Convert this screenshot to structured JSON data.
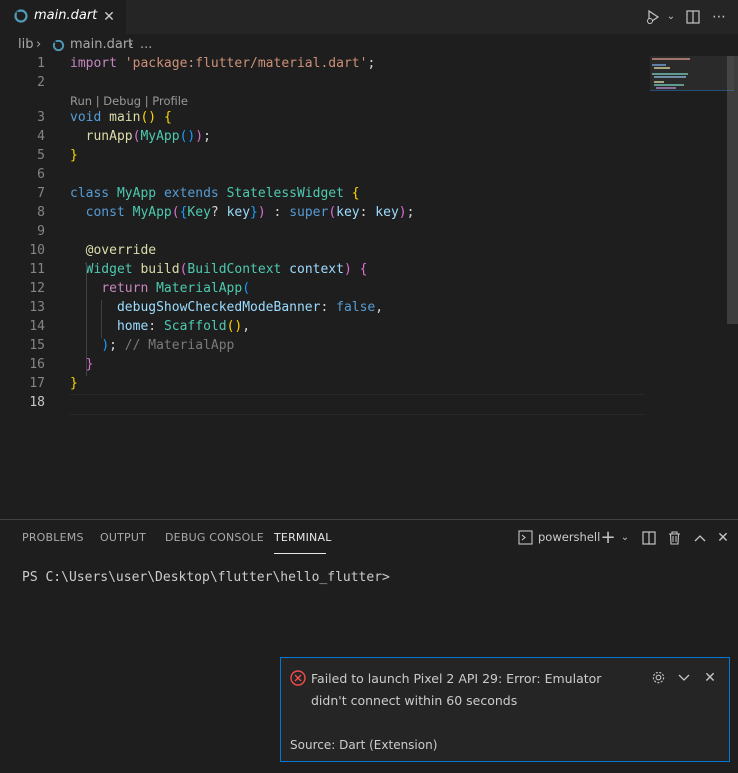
{
  "tab": {
    "title": "main.dart",
    "close": "✕"
  },
  "breadcrumb": {
    "folder": "lib",
    "sep1": "›",
    "file": "main.dart",
    "sep2": "›",
    "more": "..."
  },
  "editor": {
    "code_lens": "Run | Debug | Profile",
    "line_numbers": [
      "1",
      "2",
      "3",
      "4",
      "5",
      "6",
      "7",
      "8",
      "9",
      "10",
      "11",
      "12",
      "13",
      "14",
      "15",
      "16",
      "17",
      "18"
    ],
    "active_line": "18",
    "comment": "// MaterialApp"
  },
  "panel": {
    "tabs": {
      "problems": "PROBLEMS",
      "output": "OUTPUT",
      "debug_console": "DEBUG CONSOLE",
      "terminal": "TERMINAL"
    },
    "shell": "powershell",
    "terminal_prompt": "PS C:\\Users\\user\\Desktop\\flutter\\hello_flutter>"
  },
  "notification": {
    "message": "Failed to launch Pixel 2 API 29: Error: Emulator didn't connect within 60 seconds",
    "source": "Source: Dart (Extension)"
  },
  "colors": {
    "accent": "#0078d4",
    "error": "#f14c4c",
    "dart_icon": "#519aba"
  },
  "icons": [
    "dart-file-icon",
    "run-debug-icon",
    "chevron-down-icon",
    "split-editor-icon",
    "more-actions-icon",
    "terminal-icon",
    "plus-icon",
    "trash-icon",
    "maximize-icon",
    "close-icon",
    "error-icon",
    "gear-icon"
  ]
}
